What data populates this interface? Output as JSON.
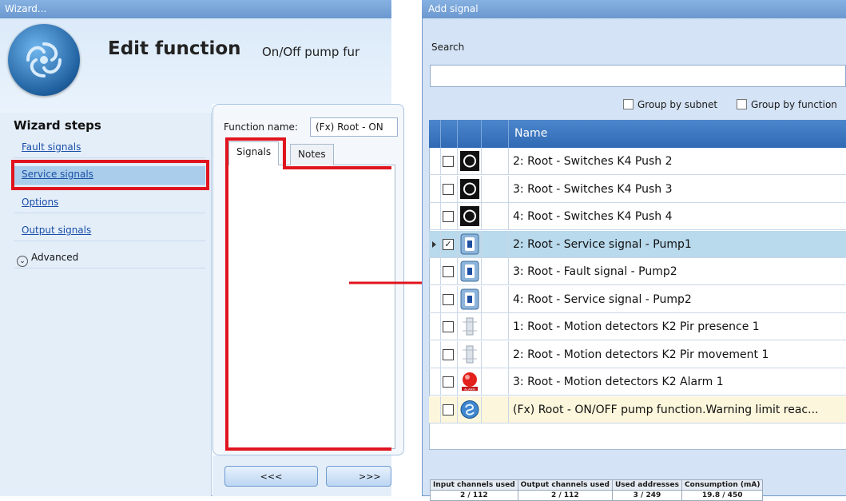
{
  "wizard": {
    "title": "Wizard...",
    "heading": "Edit function",
    "function_subtitle": "On/Off pump fur",
    "steps_title": "Wizard steps",
    "steps": [
      {
        "label": "Fault signals"
      },
      {
        "label": "Service signals"
      },
      {
        "label": "Options"
      },
      {
        "label": "Output signals"
      }
    ],
    "advanced_label": "Advanced",
    "function_name_label": "Function name:",
    "function_name_value": "(Fx) Root - ON",
    "tabs": [
      {
        "label": "Signals"
      },
      {
        "label": "Notes"
      }
    ],
    "prev_button": "<<<",
    "next_button": ">>>"
  },
  "add_signal": {
    "title": "Add signal",
    "search_label": "Search",
    "search_value": "",
    "group_by_subnet": "Group by subnet",
    "group_by_function": "Group by function",
    "column_name": "Name",
    "rows": [
      {
        "name": "2: Root - Switches K4 Push 2",
        "icon": "push-button-icon",
        "checked": false
      },
      {
        "name": "3: Root - Switches K4 Push 3",
        "icon": "push-button-icon",
        "checked": false
      },
      {
        "name": "4: Root - Switches K4 Push 4",
        "icon": "push-button-icon",
        "checked": false
      },
      {
        "name": "2: Root - Service signal - Pump1",
        "icon": "pump-signal-icon",
        "checked": true
      },
      {
        "name": "3: Root - Fault signal - Pump2",
        "icon": "pump-signal-icon",
        "checked": false
      },
      {
        "name": "4: Root - Service signal - Pump2",
        "icon": "pump-signal-icon",
        "checked": false
      },
      {
        "name": "1: Root - Motion detectors K2 Pir presence 1",
        "icon": "motion-detector-icon",
        "checked": false
      },
      {
        "name": "2: Root - Motion detectors K2 Pir movement 1",
        "icon": "motion-detector-icon",
        "checked": false
      },
      {
        "name": "3: Root - Motion detectors K2 Alarm 1",
        "icon": "alarm-icon",
        "checked": false
      },
      {
        "name": "(Fx) Root - ON/OFF pump function.Warning limit reac...",
        "icon": "function-icon",
        "checked": false
      }
    ],
    "status": {
      "headers": [
        "Input channels used",
        "Output channels used",
        "Used addresses",
        "Consumption (mA)"
      ],
      "values": [
        "2 / 112",
        "2 / 112",
        "3 / 249",
        "19.8 / 450"
      ]
    }
  },
  "colors": {
    "highlight_red": "#e0141e",
    "selected_row": "#b9d9ec",
    "header_blue": "#2f6ab4"
  }
}
